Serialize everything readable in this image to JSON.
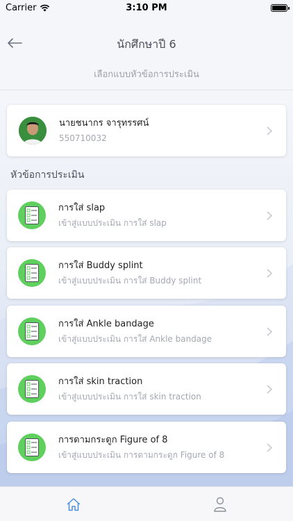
{
  "status_bar": {
    "carrier": "Carrier",
    "time": "3:10 PM"
  },
  "nav": {
    "title": "นักศึกษาปี 6",
    "subtitle": "เลือกแบบหัวข้อการประเมิน"
  },
  "student": {
    "name": "นายชนากร จารุทรรศน์",
    "id": "550710032"
  },
  "section_label": "หัวข้อการประเมิน",
  "items": [
    {
      "title": "การใส่ slap",
      "subtitle": "เข้าสู่แบบประเมิน การใส่ slap"
    },
    {
      "title": "การใส่ Buddy splint",
      "subtitle": "เข้าสู่แบบประเมิน การใส่ Buddy splint"
    },
    {
      "title": "การใส่ Ankle bandage",
      "subtitle": "เข้าสู่แบบประเมิน การใส่ Ankle bandage"
    },
    {
      "title": "การใส่ skin traction",
      "subtitle": "เข้าสู่แบบประเมิน การใส่ skin traction"
    },
    {
      "title": "การดามกระดูก Figure of 8",
      "subtitle": "เข้าสู่แบบประเมิน การดามกระดูก Figure of 8"
    }
  ],
  "tabbar": {
    "tabs": [
      "home-icon",
      "profile-icon"
    ],
    "active": "home"
  },
  "colors": {
    "accent": "#5fcf5d",
    "tab_active": "#4a90e2"
  }
}
